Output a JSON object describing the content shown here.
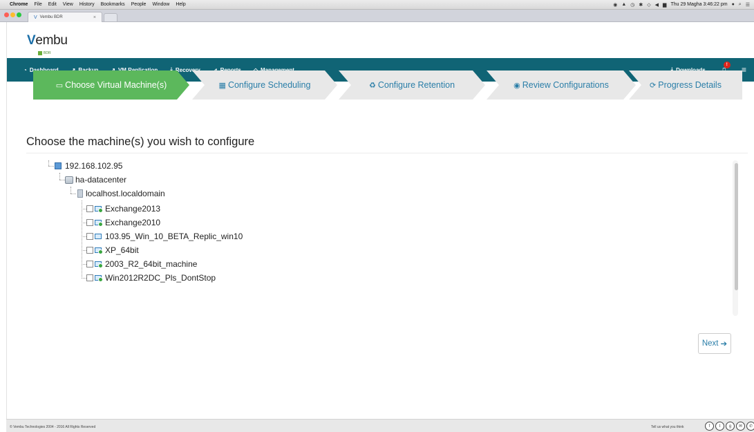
{
  "mac_menubar": {
    "apple_icon": "apple-icon",
    "items": [
      "Chrome",
      "File",
      "Edit",
      "View",
      "History",
      "Bookmarks",
      "People",
      "Window",
      "Help"
    ],
    "clock": "Thu 29 Magha 3:46:22 pm"
  },
  "browser": {
    "tab_title": "Vembu BDR",
    "tab_close": "×"
  },
  "brand": {
    "logo": "embu",
    "logo_v": "V",
    "sub": "BDR"
  },
  "nav": {
    "items": [
      {
        "label": "Dashboard",
        "icon": "dashboard-icon"
      },
      {
        "label": "Backup",
        "icon": "backup-icon"
      },
      {
        "label": "VM Replication",
        "icon": "vm-replication-icon"
      },
      {
        "label": "Recovery",
        "icon": "recovery-icon"
      },
      {
        "label": "Reports",
        "icon": "reports-icon"
      },
      {
        "label": "Management",
        "icon": "management-icon"
      }
    ],
    "downloads": "Downloads",
    "bell_badge": "!"
  },
  "wizard": {
    "steps": [
      {
        "label": "Choose Virtual Machine(s)",
        "icon": "monitor-icon",
        "active": true
      },
      {
        "label": "Configure Scheduling",
        "icon": "calendar-icon",
        "active": false
      },
      {
        "label": "Configure Retention",
        "icon": "recycle-icon",
        "active": false
      },
      {
        "label": "Review Configurations",
        "icon": "eye-icon",
        "active": false
      },
      {
        "label": "Progress Details",
        "icon": "refresh-icon",
        "active": false
      }
    ]
  },
  "page": {
    "title": "Choose the machine(s) you wish to configure"
  },
  "tree": {
    "server": "192.168.102.95",
    "datacenter": "ha-datacenter",
    "host": "localhost.localdomain",
    "vms": [
      {
        "name": "Exchange2013",
        "powered_on": true
      },
      {
        "name": "Exchange2010",
        "powered_on": true
      },
      {
        "name": "103.95_Win_10_BETA_Replic_win10",
        "powered_on": false
      },
      {
        "name": "XP_64bit",
        "powered_on": true
      },
      {
        "name": "2003_R2_64bit_machine",
        "powered_on": true
      },
      {
        "name": "Win2012R2DC_Pls_DontStop",
        "powered_on": true
      }
    ]
  },
  "actions": {
    "next": "Next"
  },
  "footer": {
    "copyright": "© Vembu Technologies  2004 - 2016  All Rights Reserved",
    "feedback": "Tell us what you think"
  }
}
